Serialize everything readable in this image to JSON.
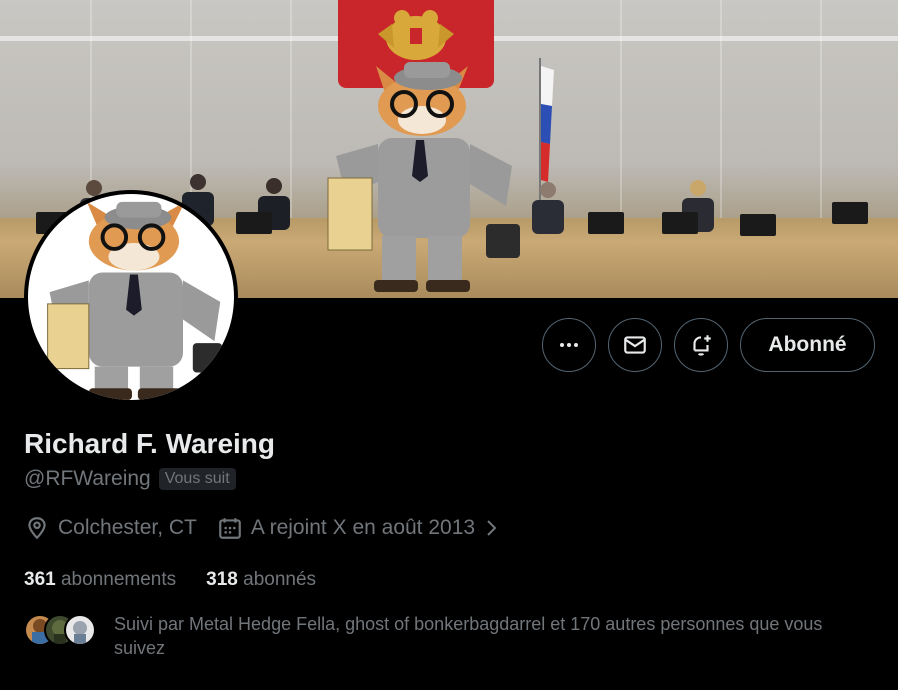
{
  "profile": {
    "display_name": "Richard F. Wareing",
    "handle": "@RFWareing",
    "follows_you_badge": "Vous suit",
    "location": "Colchester, CT",
    "joined": "A rejoint X en août 2013",
    "following_count": "361",
    "following_label": "abonnements",
    "followers_count": "318",
    "followers_label": "abonnés",
    "followed_by_text": "Suivi par Metal Hedge Fella, ghost of bonkerbagdarrel et 170 autres personnes que vous suivez"
  },
  "actions": {
    "more_icon": "more-icon",
    "message_icon": "mail-icon",
    "notify_icon": "bell-plus-icon",
    "follow_label": "Abonné"
  },
  "icons": {
    "location": "location-pin-icon",
    "calendar": "calendar-icon",
    "chevron": "chevron-right-icon"
  },
  "colors": {
    "background": "#000000",
    "text_primary": "#e7e9ea",
    "text_secondary": "#71767b",
    "border": "#536471"
  }
}
